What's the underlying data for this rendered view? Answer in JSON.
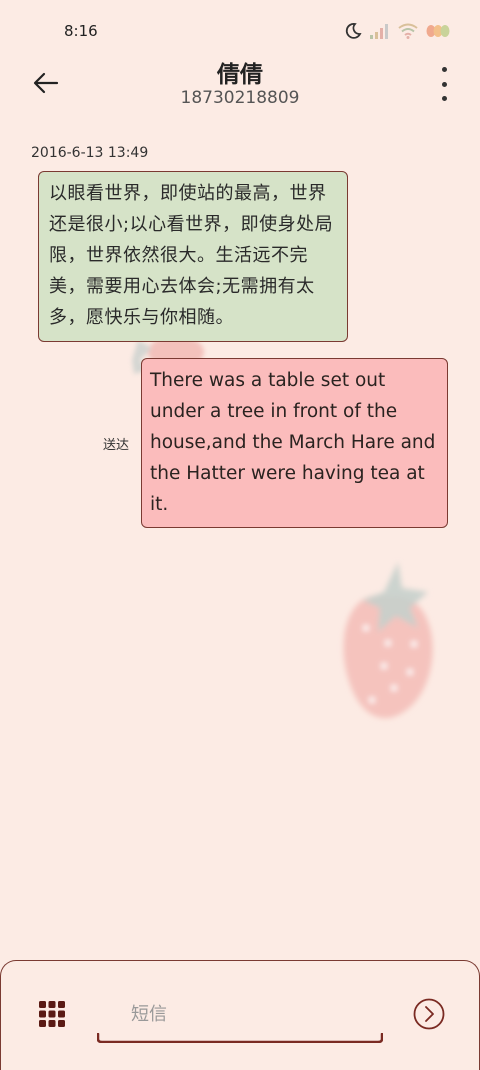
{
  "status_bar": {
    "time": "8:16"
  },
  "header": {
    "contact_name": "倩倩",
    "contact_number": "18730218809"
  },
  "icons": {
    "back": "arrow-left-icon",
    "more": "more-vertical-icon",
    "grid": "grid-icon",
    "send": "send-chevron-icon",
    "moon": "moon-icon",
    "signal": "signal-icon",
    "wifi": "wifi-icon",
    "battery": "battery-icon"
  },
  "conversation": {
    "timestamp": "2016-6-13 13:49",
    "messages": [
      {
        "direction": "incoming",
        "text": "以眼看世界，即使站的最高，世界还是很小;以心看世界，即使身处局限，世界依然很大。生活远不完美，需要用心去体会;无需拥有太多，愿快乐与你相随。"
      },
      {
        "direction": "outgoing",
        "text": "There was a table set out under a tree in front of the house,and the March Hare and the Hatter were having tea at it.",
        "status": "送达"
      }
    ]
  },
  "compose": {
    "placeholder": "短信",
    "value": ""
  },
  "colors": {
    "background": "#fcebe4",
    "incoming_bubble": "#d6e3c8",
    "outgoing_bubble": "#fbbcbc",
    "border": "#7a3a32",
    "grid_icon": "#5a1a14"
  }
}
